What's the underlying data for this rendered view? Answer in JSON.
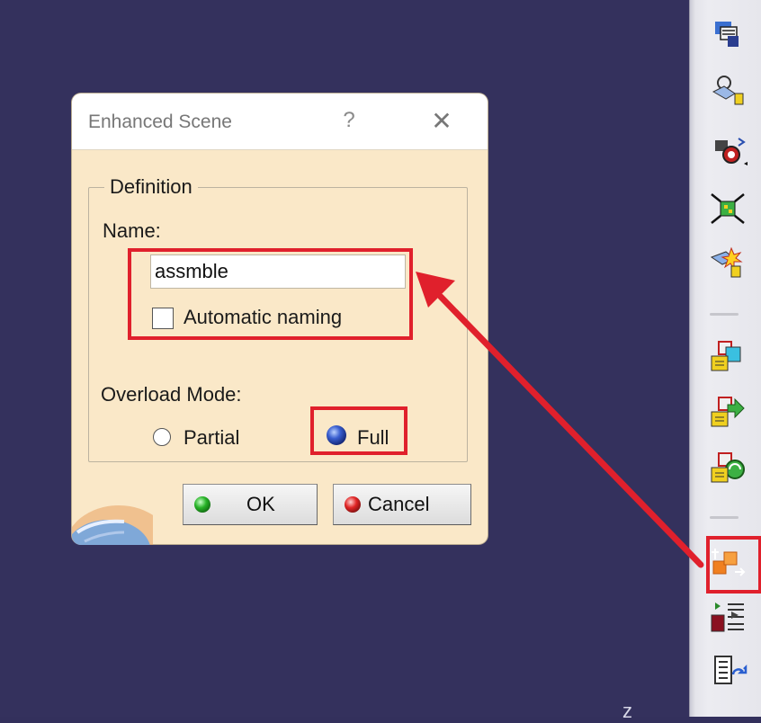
{
  "dialog": {
    "title": "Enhanced Scene",
    "help_label": "?",
    "close_label": "✕",
    "definition_legend": "Definition",
    "name_label": "Name:",
    "name_value": "assmble",
    "auto_naming_label": "Automatic naming",
    "auto_naming_checked": false,
    "overload_label": "Overload Mode:",
    "overload_options": [
      "Partial",
      "Full"
    ],
    "overload_selected": "Full",
    "ok_label": "OK",
    "cancel_label": "Cancel"
  },
  "viewport": {
    "axis_letter": "z"
  },
  "toolbar": {
    "icons": [
      "render-scene-icon",
      "lights-icon",
      "camera-icon",
      "fit-all-icon",
      "explode-icon",
      "scene-copy-icon",
      "scene-forward-icon",
      "scene-refresh-icon",
      "enhanced-scene-icon",
      "scene-browser-icon",
      "scene-apply-icon"
    ],
    "highlighted_icon": "enhanced-scene-icon"
  },
  "colors": {
    "background": "#34315d",
    "dialog": "#fae8c8",
    "highlight": "#e0202c",
    "toolbar": "#e8e8ee"
  }
}
